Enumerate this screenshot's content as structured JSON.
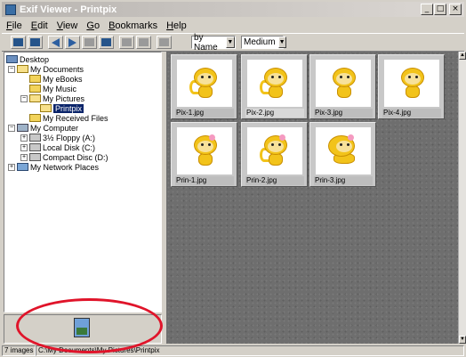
{
  "window": {
    "title": "Exif Viewer - Printpix"
  },
  "menu": [
    "File",
    "Edit",
    "View",
    "Go",
    "Bookmarks",
    "Help"
  ],
  "toolbar": {
    "sort_label": "by Name",
    "size_label": "Medium"
  },
  "tree": {
    "desktop": "Desktop",
    "my_documents": "My Documents",
    "my_ebooks": "My eBooks",
    "my_music": "My Music",
    "my_pictures": "My Pictures",
    "printpix": "Printpix",
    "my_received_files": "My Received Files",
    "my_computer": "My Computer",
    "floppy": "3½ Floppy (A:)",
    "local_disk": "Local Disk (C:)",
    "compact_disc": "Compact Disc (D:)",
    "network_places": "My Network Places"
  },
  "thumbnails": [
    "Pix-1.jpg",
    "Pix-2.jpg",
    "Pix-3.jpg",
    "Pix-4.jpg",
    "Prin-1.jpg",
    "Prin-2.jpg",
    "Prin-3.jpg"
  ],
  "status": {
    "count": "7 images",
    "path": "C:\\My Documents\\My Pictures\\Printpix"
  },
  "colors": {
    "accent": "#e0142a",
    "selection": "#0a246a"
  }
}
